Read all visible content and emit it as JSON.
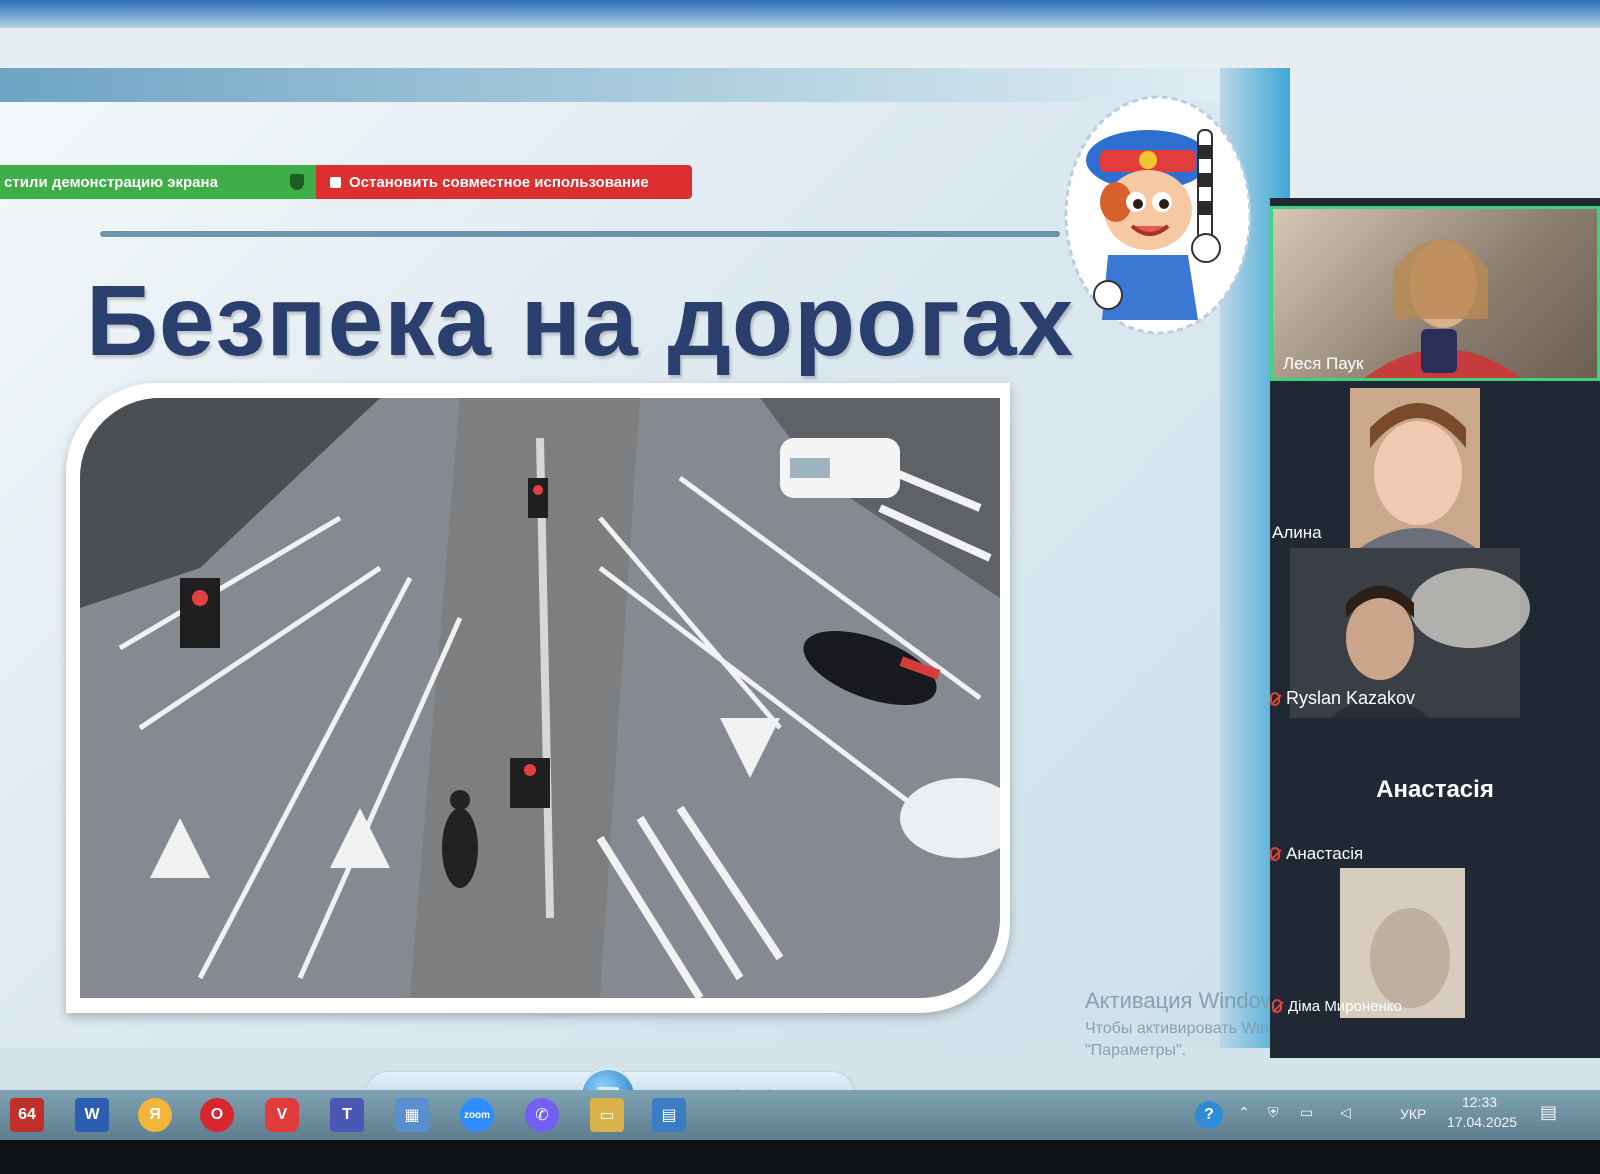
{
  "share_bar": {
    "status_label": "стили демонстрацию экрана",
    "stop_label": "Остановить совместное использование"
  },
  "slide": {
    "title": "Безпека на дорогах"
  },
  "participants": [
    {
      "name": "Леся Паук",
      "video": true,
      "active_speaker": true,
      "muted": false
    },
    {
      "name": "Алина",
      "video": true,
      "active_speaker": false,
      "muted": false
    },
    {
      "name": "Ryslan Kazakov",
      "video": true,
      "active_speaker": false,
      "muted": true
    },
    {
      "name": "Анастасія",
      "display_name": "Анастасія",
      "video": false,
      "active_speaker": false,
      "muted": true
    },
    {
      "name": "Діма Мироненко",
      "video": true,
      "active_speaker": false,
      "muted": true
    }
  ],
  "watermark": {
    "title": "Активация Windows",
    "subtitle": "Чтобы активировать Windows, перейдите в раздел \"Параметры\"."
  },
  "slideshow_controls": {
    "zoom_icon": "zoom-icon",
    "fit_icon": "fit-icon",
    "prev_icon": "previous-icon",
    "play_icon": "slideshow-icon",
    "next_icon": "next-icon",
    "rotate_left_icon": "rotate-left-icon",
    "rotate_right_icon": "rotate-right-icon",
    "delete_icon": "delete-icon"
  },
  "taskbar": {
    "badge": "64",
    "apps": [
      "word-icon",
      "yandex-icon",
      "opera-icon",
      "vivaldi-icon",
      "teams-icon",
      "folder-app-icon",
      "zoom-icon",
      "viber-icon",
      "explorer-icon",
      "photos-icon"
    ],
    "language": "УКР",
    "time": "12:33",
    "date": "17.04.2025"
  },
  "colors": {
    "share_green": "#3fae49",
    "share_red": "#dc2f2f",
    "title_navy": "#2a3f6d",
    "active_speaker_border": "#3fd27a",
    "sidebar_bg": "#202833"
  }
}
